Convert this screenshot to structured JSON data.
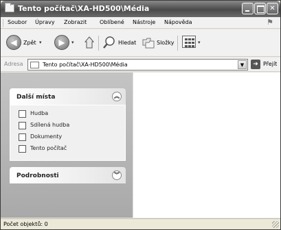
{
  "window": {
    "title": "Tento počítač\\XA-HD500\\Média"
  },
  "menu": [
    "Soubor",
    "Úpravy",
    "Zobrazit",
    "Oblíbené",
    "Nástroje",
    "Nápověda"
  ],
  "toolbar": {
    "back_label": "Zpět",
    "search_label": "Hledat",
    "folders_label": "Složky"
  },
  "address": {
    "label": "Adresa",
    "value": "Tento počítač\\XA-HD500\\Média",
    "go_label": "Přejít"
  },
  "tasks": {
    "other_places": {
      "title": "Další místa",
      "items": [
        "Hudba",
        "Sdílená hudba",
        "Dokumenty",
        "Tento počítač"
      ]
    },
    "details": {
      "title": "Podrobnosti"
    }
  },
  "status": {
    "text": "Počet objektů: 0"
  }
}
